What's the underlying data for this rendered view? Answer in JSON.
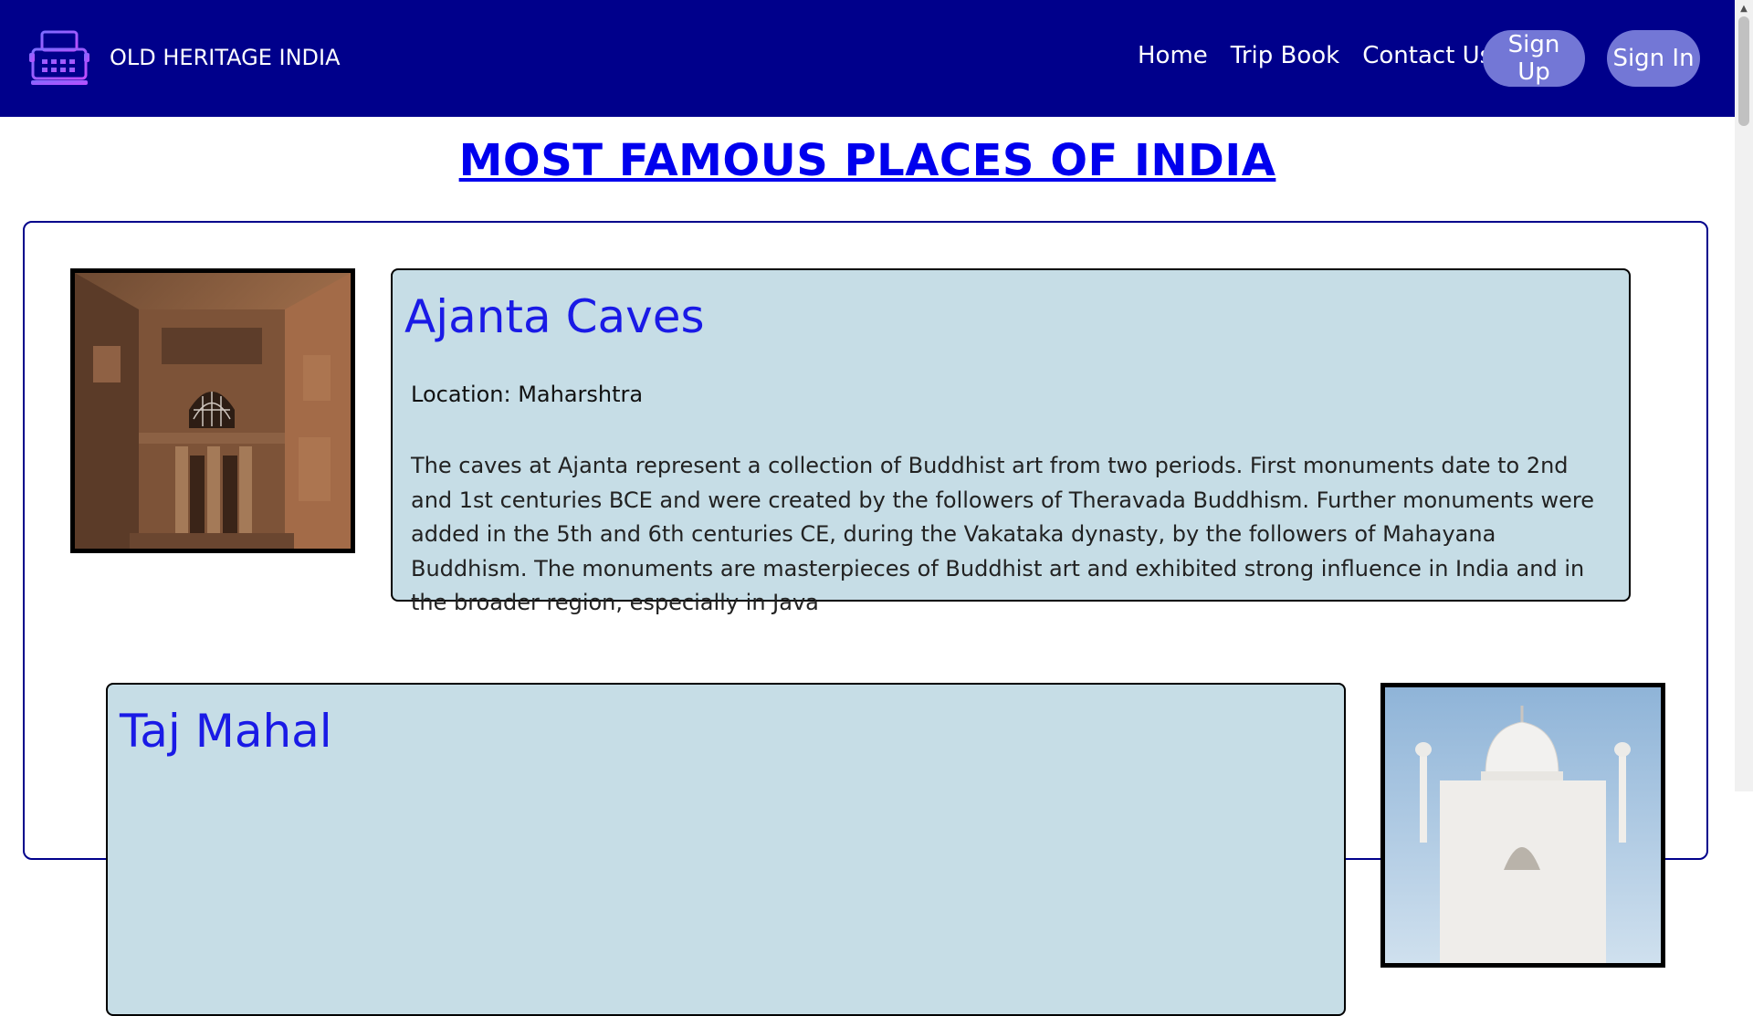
{
  "header": {
    "brand": "OLD HERITAGE INDIA",
    "logo_icon": "typewriter-icon",
    "nav": [
      "Home",
      "Trip Book",
      "Contact Us"
    ],
    "signup_label": "Sign Up",
    "signin_label": "Sign In",
    "bg_color": "#00008b",
    "button_color": "#7377d6"
  },
  "page_title": "MOST FAMOUS PLACES OF INDIA",
  "places": [
    {
      "name": "Ajanta Caves",
      "location": "Location: Maharshtra",
      "description": "The caves at Ajanta represent a collection of Buddhist art from two periods. First monuments date to 2nd and 1st centuries BCE and were created by the followers of Theravada Buddhism. Further monuments were added in the 5th and 6th centuries CE, during the Vakataka dynasty, by the followers of Mahayana Buddhism. The monuments are masterpieces of Buddhist art and exhibited strong influence in India and in the broader region, especially in Java",
      "image": "ajanta-caves-photo"
    },
    {
      "name": "Taj Mahal",
      "image": "taj-mahal-photo"
    }
  ],
  "colors": {
    "card_bg": "#c6dde6",
    "heading": "#1a1ae6",
    "title_link": "#0000ee"
  }
}
